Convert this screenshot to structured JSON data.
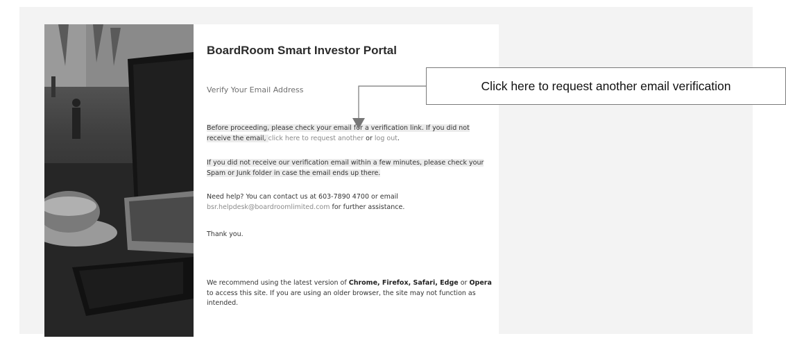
{
  "portal": {
    "title": "BoardRoom Smart Investor Portal",
    "subtitle": "Verify Your Email Address"
  },
  "paragraphs": {
    "p1_pre": "Before proceeding, please check your email for a verification link. If you did not receive the email, ",
    "p1_link1": "click here to request another",
    "p1_mid": " or ",
    "p1_link2": "log out",
    "p1_end": ".",
    "p2": "If you did not receive our verification email within a few minutes, please check your Spam or Junk folder in case the email ends up there.",
    "p3_pre": "Need help? You can contact us at 603-7890 4700 or email ",
    "p3_email": "bsr.helpdesk@boardroomlimited.com",
    "p3_post": " for further assistance.",
    "p4": "Thank you.",
    "p5_pre": "We recommend using the latest version of ",
    "p5_browsers1": "Chrome, Firefox, Safari, Edge",
    "p5_or": " or ",
    "p5_browsers2": "Opera",
    "p5_post": " to access this site. If you are using an older browser, the site may not function as intended."
  },
  "callout": {
    "text": "Click here to request another email verification"
  }
}
